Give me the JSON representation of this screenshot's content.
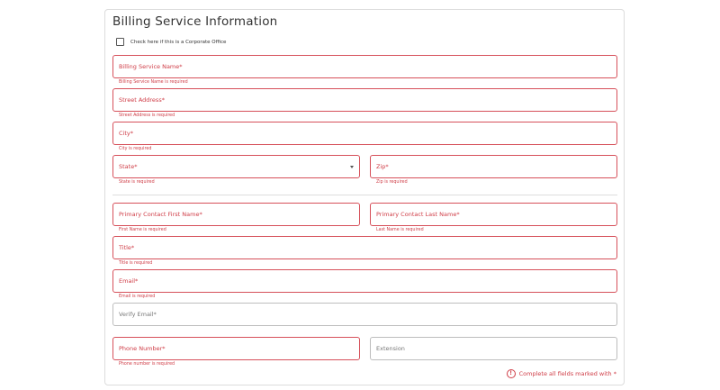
{
  "section": {
    "title": "Billing Service Information"
  },
  "corporate": {
    "label": "Check here if this is a Corporate Office",
    "checked": false
  },
  "fields": {
    "billing_service_name": {
      "label": "Billing Service Name*",
      "error": "Billing Service Name is required"
    },
    "street_address": {
      "label": "Street Address*",
      "error": "Street Address is required"
    },
    "city": {
      "label": "City*",
      "error": "City is required"
    },
    "state": {
      "label": "State*",
      "error": "State is required"
    },
    "zip": {
      "label": "Zip*",
      "error": "Zip is required"
    },
    "first_name": {
      "label": "Primary Contact First Name*",
      "error": "First Name is required"
    },
    "last_name": {
      "label": "Primary Contact Last Name*",
      "error": "Last Name is required"
    },
    "title": {
      "label": "Title*",
      "error": "Title is required"
    },
    "email": {
      "label": "Email*",
      "error": "Email is required"
    },
    "verify_email": {
      "label": "Verify Email*"
    },
    "phone": {
      "label": "Phone Number*",
      "error": "Phone number is required"
    },
    "extension": {
      "label": "Extension"
    }
  },
  "footer": {
    "note": "Complete all fields marked with *",
    "icon": "!"
  },
  "colors": {
    "error": "#cf3c46",
    "border_normal": "#bdbdbd",
    "card_border": "#dcdcdc"
  }
}
